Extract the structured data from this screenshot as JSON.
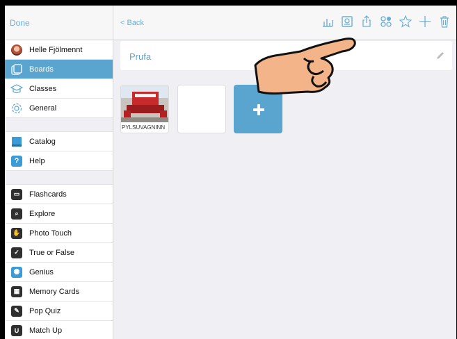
{
  "sidebar": {
    "done_label": "Done",
    "items": [
      {
        "label": "Helle Fjölmennt",
        "icon": "avatar-icon",
        "selected": false
      },
      {
        "label": "Boards",
        "icon": "boards-icon",
        "selected": true
      },
      {
        "label": "Classes",
        "icon": "classes-icon",
        "selected": false
      },
      {
        "label": "General",
        "icon": "gear-icon",
        "selected": false
      }
    ],
    "items2": [
      {
        "label": "Catalog",
        "icon": "book-icon"
      },
      {
        "label": "Help",
        "icon": "help-icon"
      }
    ],
    "games": [
      {
        "label": "Flashcards",
        "icon": "flashcards-icon"
      },
      {
        "label": "Explore",
        "icon": "explore-icon"
      },
      {
        "label": "Photo Touch",
        "icon": "photo-touch-icon"
      },
      {
        "label": "True or False",
        "icon": "true-false-icon"
      },
      {
        "label": "Genius",
        "icon": "genius-icon"
      },
      {
        "label": "Memory Cards",
        "icon": "memory-cards-icon"
      },
      {
        "label": "Pop Quiz",
        "icon": "pop-quiz-icon"
      },
      {
        "label": "Match Up",
        "icon": "match-up-icon"
      }
    ]
  },
  "topbar": {
    "back_label": "< Back",
    "tools": [
      "chart-icon",
      "preview-icon",
      "share-icon",
      "grid-icon",
      "star-icon",
      "plus-icon",
      "trash-icon"
    ]
  },
  "board": {
    "title": "Prufa",
    "cards": [
      {
        "caption": "PYLSUVAGNINN"
      }
    ]
  },
  "colors": {
    "accent": "#5aa5cf",
    "link": "#6aaed6",
    "hand_skin": "#f4b48a"
  }
}
